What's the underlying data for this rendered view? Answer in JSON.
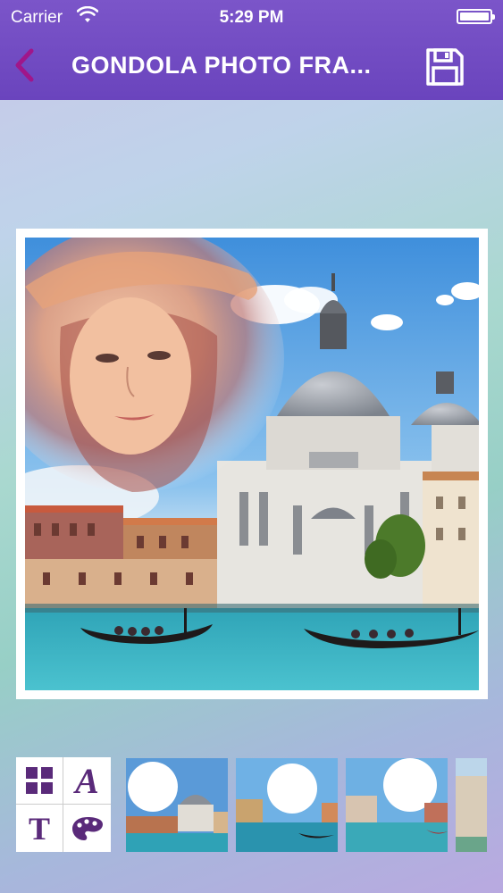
{
  "status_bar": {
    "carrier": "Carrier",
    "time": "5:29 PM"
  },
  "nav": {
    "title": "GONDOLA PHOTO FRA...",
    "back_icon": "chevron-left-icon",
    "save_icon": "floppy-disk-icon"
  },
  "tools": {
    "items": [
      {
        "name": "grid-icon"
      },
      {
        "name": "text-style-icon",
        "glyph": "A"
      },
      {
        "name": "text-icon",
        "glyph": "T"
      },
      {
        "name": "palette-icon"
      }
    ]
  },
  "frames": {
    "count_visible": 4
  },
  "colors": {
    "nav_bg": "#6a44bd",
    "accent": "#5a2a7a"
  }
}
